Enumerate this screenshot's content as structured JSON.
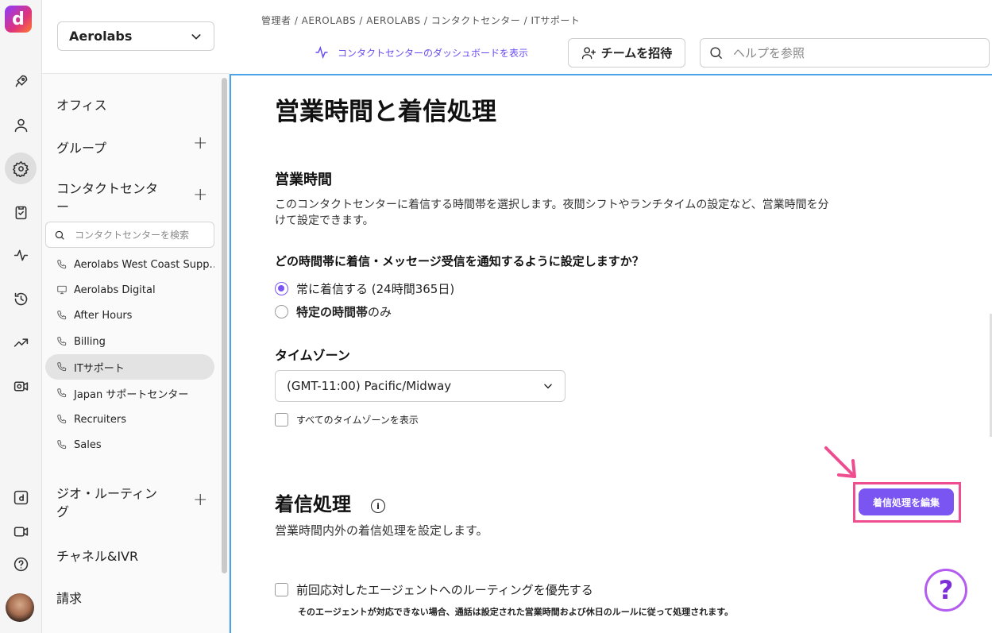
{
  "rail": {
    "logo_letter": "d"
  },
  "nav": {
    "org": "Aerolabs",
    "sections": {
      "office": "オフィス",
      "group": "グループ",
      "contact_center": "コンタクトセンター",
      "geo_routing": "ジオ・ルーティング",
      "channel_ivr": "チャネル&IVR",
      "billing": "請求"
    },
    "plus": "+",
    "search_placeholder": "コンタクトセンターを検索",
    "items": [
      {
        "label": "Aerolabs West Coast Supp...",
        "icon": "phone-icon"
      },
      {
        "label": "Aerolabs Digital",
        "icon": "monitor-icon"
      },
      {
        "label": "After Hours",
        "icon": "phone-icon"
      },
      {
        "label": "Billing",
        "icon": "phone-icon"
      },
      {
        "label": "ITサポート",
        "icon": "phone-icon"
      },
      {
        "label": "Japan サポートセンター",
        "icon": "phone-icon"
      },
      {
        "label": "Recruiters",
        "icon": "phone-icon"
      },
      {
        "label": "Sales",
        "icon": "phone-icon"
      }
    ]
  },
  "header": {
    "breadcrumb": "管理者 / AEROLABS / AEROLABS / コンタクトセンター / ITサポート",
    "dashboard_link": "コンタクトセンターのダッシュボードを表示",
    "invite_label": "チームを招待",
    "help_placeholder": "ヘルプを参照"
  },
  "main": {
    "title": "営業時間と着信処理",
    "hours": {
      "title": "営業時間",
      "desc": "このコンタクトセンターに着信する時間帯を選択します。夜間シフトやランチタイムの設定など、営業時間を分けて設定できます。",
      "question": "どの時間帯に着信・メッセージ受信を通知するように設定しますか？",
      "option_always": "常に着信する (24時間365日)",
      "option_specific_bold": "特定の時間帯",
      "option_specific_rest": "のみ",
      "selected": "always"
    },
    "timezone": {
      "title": "タイムゾーン",
      "value": "(GMT-11:00) Pacific/Midway",
      "show_all": "すべてのタイムゾーンを表示"
    },
    "routing": {
      "title": "着信処理",
      "desc": "営業時間内外の着信処理を設定します。",
      "edit_button": "着信処理を編集",
      "prioritize": "前回応対したエージェントへのルーティングを優先する",
      "note": "そのエージェントが対応できない場合、通話は設定された営業時間および休日のルールに従って処理されます。"
    },
    "help_glyph": "?"
  },
  "colors": {
    "accent": "#7b55f2",
    "highlight": "#ee4d8f",
    "focus_border": "#4aa3e8"
  }
}
